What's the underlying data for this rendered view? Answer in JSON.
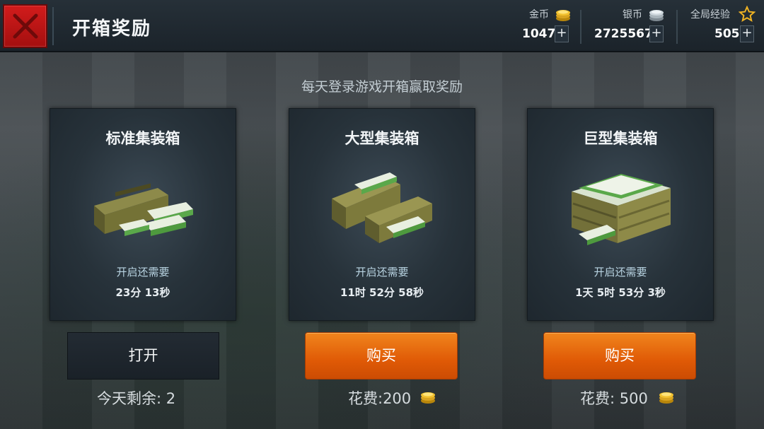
{
  "header": {
    "title": "开箱奖励",
    "currencies": [
      {
        "label": "金币",
        "value": "1047",
        "icon": "gold-coin-icon"
      },
      {
        "label": "银币",
        "value": "2725567",
        "icon": "silver-coin-icon"
      },
      {
        "label": "全局经验",
        "value": "505",
        "icon": "star-icon"
      }
    ],
    "plus_symbol": "+"
  },
  "subtitle": "每天登录游戏开箱赢取奖励",
  "crates": [
    {
      "name": "标准集装箱",
      "need_label": "开启还需要",
      "timer": "23分 13秒",
      "button": "打开",
      "footer": "今天剩余: 2"
    },
    {
      "name": "大型集装箱",
      "need_label": "开启还需要",
      "timer": "11时 52分 58秒",
      "button": "购买",
      "footer": "花费:200"
    },
    {
      "name": "巨型集装箱",
      "need_label": "开启还需要",
      "timer": "1天 5时 53分 3秒",
      "button": "购买",
      "footer": "花费: 500"
    }
  ],
  "colors": {
    "close_button": "#c41616",
    "buy_button": "#e8650f",
    "open_button": "#1f272e"
  }
}
